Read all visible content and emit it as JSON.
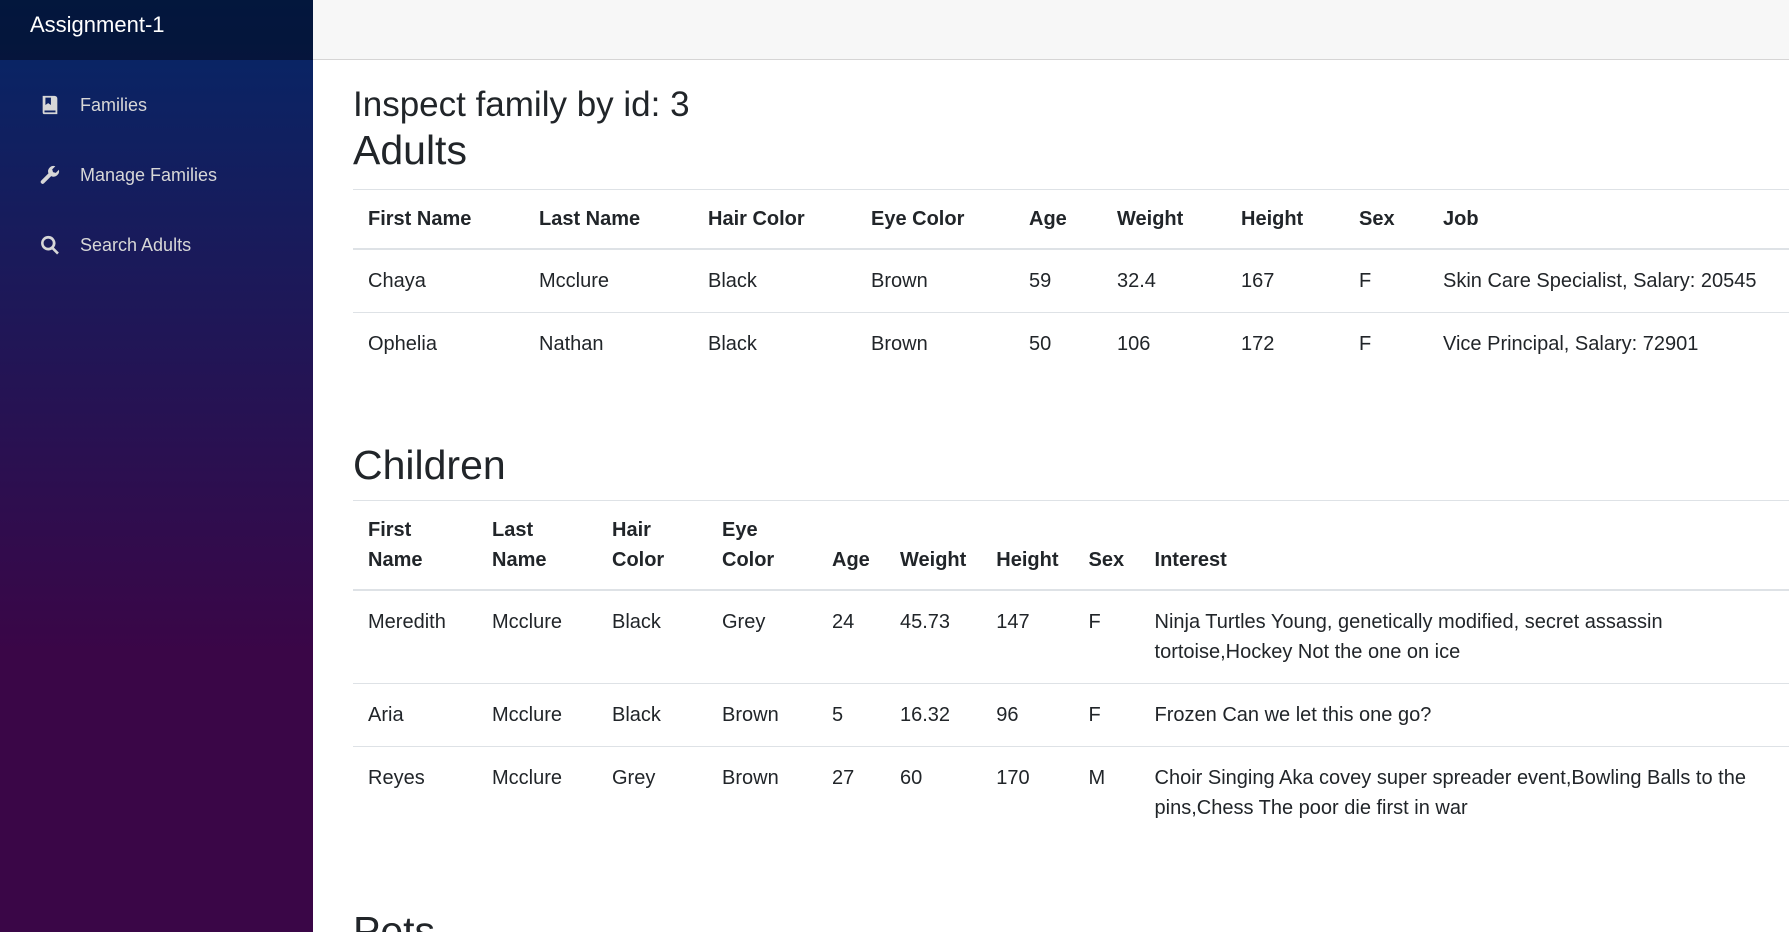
{
  "app": {
    "title": "Assignment-1"
  },
  "sidebar": {
    "items": [
      {
        "label": "Families",
        "icon": "book-icon"
      },
      {
        "label": "Manage Families",
        "icon": "wrench-icon"
      },
      {
        "label": "Search Adults",
        "icon": "search-icon"
      }
    ]
  },
  "page": {
    "title": "Inspect family by id: 3"
  },
  "adults": {
    "heading": "Adults",
    "columns": [
      "First Name",
      "Last Name",
      "Hair Color",
      "Eye Color",
      "Age",
      "Weight",
      "Height",
      "Sex",
      "Job"
    ],
    "rows": [
      [
        "Chaya",
        "Mcclure",
        "Black",
        "Brown",
        "59",
        "32.4",
        "167",
        "F",
        "Skin Care Specialist, Salary: 20545"
      ],
      [
        "Ophelia",
        "Nathan",
        "Black",
        "Brown",
        "50",
        "106",
        "172",
        "F",
        "Vice Principal, Salary: 72901"
      ]
    ]
  },
  "children": {
    "heading": "Children",
    "columns": [
      "First Name",
      "Last Name",
      "Hair Color",
      "Eye Color",
      "Age",
      "Weight",
      "Height",
      "Sex",
      "Interest"
    ],
    "rows": [
      [
        "Meredith",
        "Mcclure",
        "Black",
        "Grey",
        "24",
        "45.73",
        "147",
        "F",
        "Ninja Turtles Young, genetically modified, secret assassin tortoise,Hockey Not the one on ice"
      ],
      [
        "Aria",
        "Mcclure",
        "Black",
        "Brown",
        "5",
        "16.32",
        "96",
        "F",
        "Frozen Can we let this one go?"
      ],
      [
        "Reyes",
        "Mcclure",
        "Grey",
        "Brown",
        "27",
        "60",
        "170",
        "M",
        "Choir Singing Aka covey super spreader event,Bowling Balls to the pins,Chess The poor die first in war"
      ]
    ]
  },
  "pets": {
    "heading": "Pets"
  }
}
